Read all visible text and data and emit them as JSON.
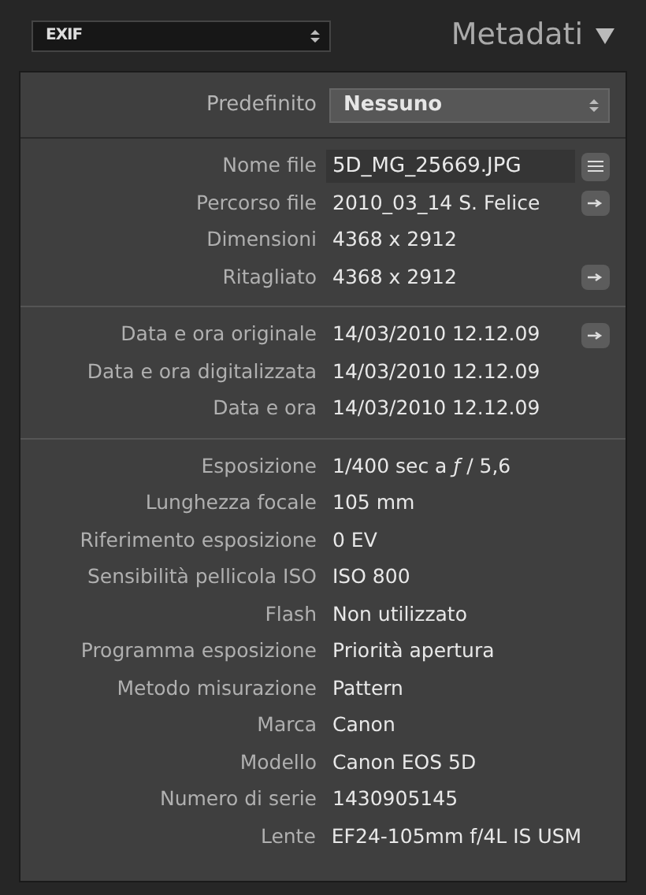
{
  "header": {
    "selector": "EXIF",
    "title": "Metadati"
  },
  "preset": {
    "label": "Predefinito",
    "value": "Nessuno"
  },
  "groups": [
    {
      "rows": [
        {
          "label": "Nome file",
          "value": "5D_MG_25669.JPG",
          "kind": "field",
          "button": {
            "kind": "list"
          }
        },
        {
          "label": "Percorso file",
          "value": "2010_03_14 S. Felice",
          "kind": "text",
          "button": {
            "kind": "arrow"
          }
        },
        {
          "label": "Dimensioni",
          "value": "4368 x 2912",
          "kind": "text"
        },
        {
          "label": "Ritagliato",
          "value": "4368 x 2912",
          "kind": "text",
          "button": {
            "kind": "arrow"
          }
        }
      ]
    },
    {
      "rows": [
        {
          "label": "Data e ora originale",
          "value": "14/03/2010 12.12.09",
          "kind": "text",
          "button": {
            "kind": "arrow"
          }
        },
        {
          "label": "Data e ora digitalizzata",
          "value": "14/03/2010 12.12.09",
          "kind": "text"
        },
        {
          "label": "Data e ora",
          "value": "14/03/2010 12.12.09",
          "kind": "text"
        }
      ]
    },
    {
      "rows": [
        {
          "label": "Esposizione",
          "value": "1/400 sec a *ƒ* / 5,6",
          "kind": "text"
        },
        {
          "label": "Lunghezza focale",
          "value": "105 mm",
          "kind": "text"
        },
        {
          "label": "Riferimento esposizione",
          "value": "0 EV",
          "kind": "text"
        },
        {
          "label": "Sensibilità pellicola ISO",
          "value": "ISO 800",
          "kind": "text"
        },
        {
          "label": "Flash",
          "value": "Non utilizzato",
          "kind": "text"
        },
        {
          "label": "Programma esposizione",
          "value": "Priorità apertura",
          "kind": "text"
        },
        {
          "label": "Metodo misurazione",
          "value": "Pattern",
          "kind": "text"
        },
        {
          "label": "Marca",
          "value": "Canon",
          "kind": "text"
        },
        {
          "label": "Modello",
          "value": "Canon EOS 5D",
          "kind": "text"
        },
        {
          "label": "Numero di serie",
          "value": "1430905145",
          "kind": "text"
        },
        {
          "label": "Lente",
          "value": "EF24-105mm f/4L IS USM",
          "kind": "text"
        }
      ]
    }
  ]
}
